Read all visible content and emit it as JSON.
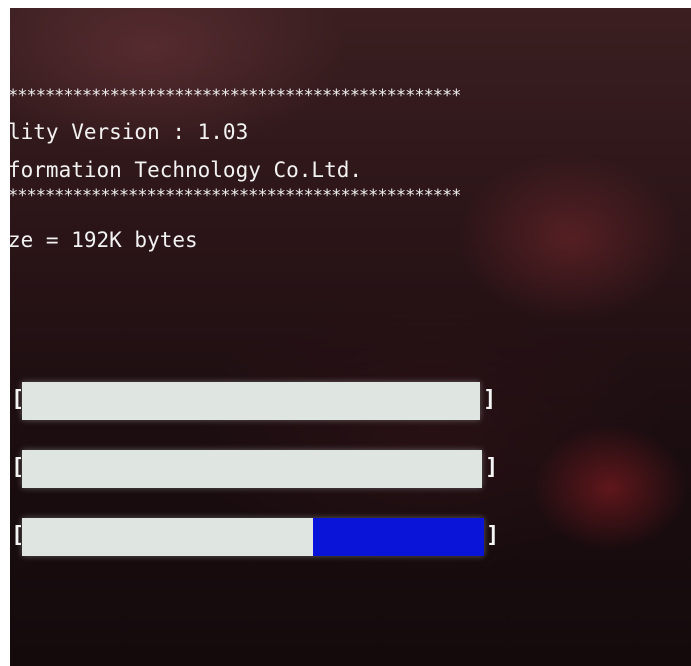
{
  "console": {
    "stars_top": "*************************************************",
    "version_line": "lity Version : 1.03",
    "company_line": "formation Technology Co.Ltd.",
    "stars_bottom": "*************************************************",
    "size_line": "ze = 192K bytes"
  },
  "progress_bars": [
    {
      "left_bracket": "[",
      "right_bracket": "]",
      "progress": 1.0,
      "fill_color": "#dfe6e2"
    },
    {
      "left_bracket": "[",
      "right_bracket": "]",
      "progress": 1.0,
      "fill_color": "#dfe6e2"
    },
    {
      "left_bracket": "[",
      "right_bracket": "]",
      "progress": 0.63,
      "fill_color": "#0a14d8"
    }
  ],
  "colors": {
    "text": "#f2f2f2",
    "bar_track": "#dfe6e2",
    "bar_remaining": "#0a14d8"
  }
}
